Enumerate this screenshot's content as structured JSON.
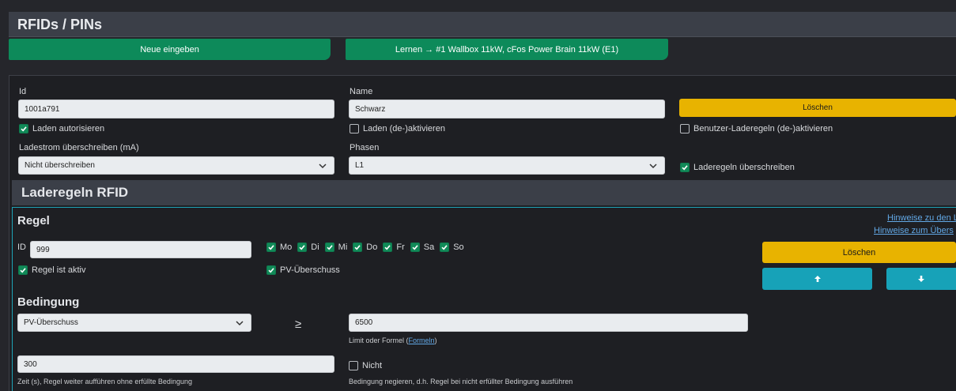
{
  "header": {
    "title": "RFIDs / PINs"
  },
  "actions": {
    "new_label": "Neue eingeben",
    "learn_label": "Lernen → #1 Wallbox 11kW, cFos Power Brain 11kW (E1)"
  },
  "rfid": {
    "id_label": "Id",
    "id_value": "1001a791",
    "name_label": "Name",
    "name_value": "Schwarz",
    "delete_label": "Löschen",
    "authorize_label": "Laden autorisieren",
    "toggle_charging_label": "Laden (de-)aktivieren",
    "toggle_user_rules_label": "Benutzer-Laderegeln (de-)aktivieren",
    "current_override_label": "Ladestrom überschreiben (mA)",
    "current_override_value": "Nicht überschreiben",
    "phases_label": "Phasen",
    "phases_value": "L1",
    "override_rules_label": "Laderegeln überschreiben"
  },
  "rules": {
    "section_title": "Laderegeln RFID",
    "rule_title": "Regel",
    "hint_links": [
      "Hinweise zu den L",
      "Hinweise zum Übers"
    ],
    "id_label": "ID",
    "id_value": "999",
    "days": [
      "Mo",
      "Di",
      "Mi",
      "Do",
      "Fr",
      "Sa",
      "So"
    ],
    "active_label": "Regel ist aktiv",
    "pv_label": "PV-Überschuss",
    "delete_label": "Löschen",
    "condition_title": "Bedingung",
    "condition_value": "PV-Überschuss",
    "operator": "≥",
    "limit_value": "6500",
    "limit_hint_prefix": "Limit oder Formel (",
    "limit_hint_link": "Formeln",
    "limit_hint_suffix": ")",
    "time_value": "300",
    "time_hint": "Zeit (s), Regel weiter aufführen ohne erfüllte Bedingung",
    "not_label": "Nicht",
    "not_hint": "Bedingung negieren, d.h. Regel bei nicht erfüllter Bedingung ausführen"
  }
}
